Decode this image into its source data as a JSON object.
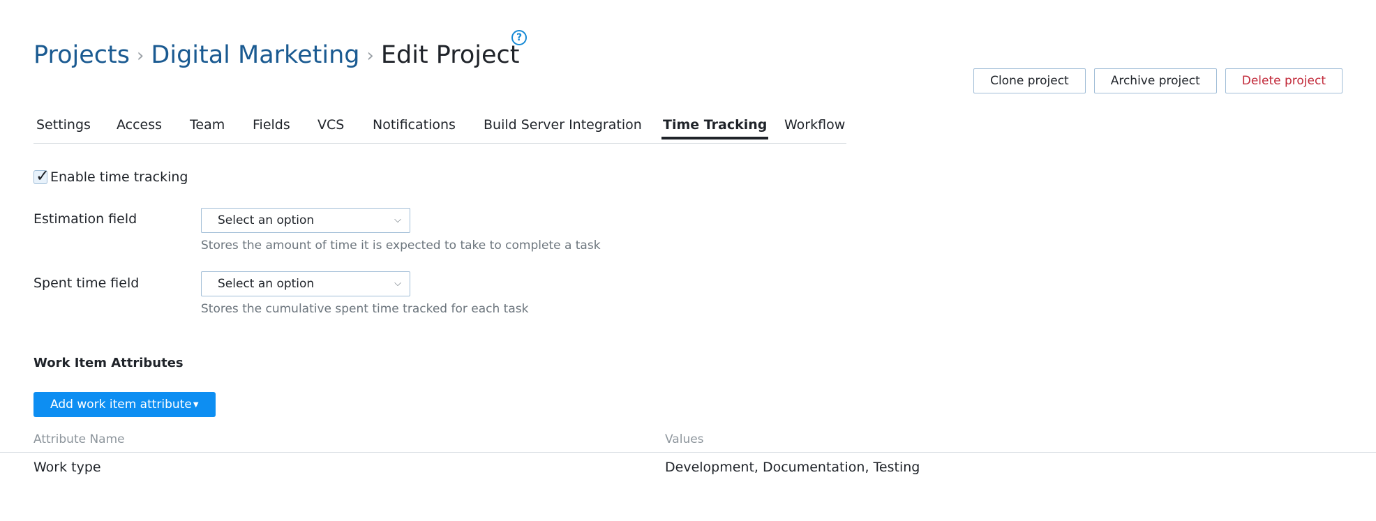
{
  "breadcrumb": {
    "items": [
      "Projects",
      "Digital Marketing"
    ],
    "separator": "›",
    "current": "Edit Project",
    "help_icon": "question-circle-icon",
    "help_glyph": "?"
  },
  "actions": {
    "clone_label": "Clone project",
    "archive_label": "Archive project",
    "delete_label": "Delete project"
  },
  "tabs": [
    {
      "label": "Settings",
      "active": false
    },
    {
      "label": "Access",
      "active": false
    },
    {
      "label": "Team",
      "active": false
    },
    {
      "label": "Fields",
      "active": false
    },
    {
      "label": "VCS",
      "active": false
    },
    {
      "label": "Notifications",
      "active": false
    },
    {
      "label": "Build Server Integration",
      "active": false
    },
    {
      "label": "Time Tracking",
      "active": true
    },
    {
      "label": "Workflow",
      "active": false
    }
  ],
  "time_tracking": {
    "enable_label": "Enable time tracking",
    "enabled": true,
    "estimation": {
      "label": "Estimation field",
      "value": "Select an option",
      "help": "Stores the amount of time it is expected to take to complete a task"
    },
    "spent_time": {
      "label": "Spent time field",
      "value": "Select an option",
      "help": "Stores the cumulative spent time tracked for each task"
    }
  },
  "work_item_attributes": {
    "title": "Work Item Attributes",
    "add_button_label": "Add work item attribute",
    "columns": [
      "Attribute Name",
      "Values"
    ],
    "rows": [
      {
        "name": "Work type",
        "values": "Development, Documentation, Testing"
      }
    ]
  },
  "colors": {
    "link": "#1a5a91",
    "primary": "#0d8ef2",
    "danger": "#c22b3b",
    "help_icon": "#1589d5"
  }
}
